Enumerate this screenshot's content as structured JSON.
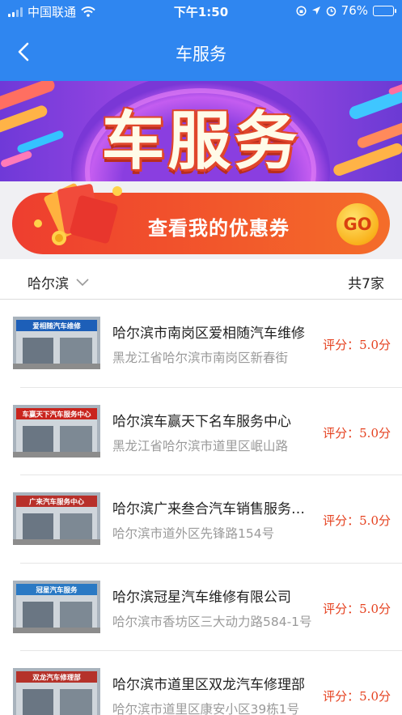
{
  "status_bar": {
    "carrier": "中国联通",
    "time": "下午1:50",
    "battery": "76%",
    "battery_level": 0.76
  },
  "nav": {
    "title": "车服务"
  },
  "banner": {
    "text": "车服务"
  },
  "coupon": {
    "label": "查看我的优惠券",
    "go_label": "GO"
  },
  "filter": {
    "city": "哈尔滨",
    "count": "共7家"
  },
  "shops": [
    {
      "name": "哈尔滨市南岗区爱相随汽车维修",
      "address": "黑龙江省哈尔滨市南岗区新春街",
      "rating": "评分：5.0分",
      "thumb_sign": "爱相随汽车维修",
      "sign_color": "#1d5fb8"
    },
    {
      "name": "哈尔滨车赢天下名车服务中心",
      "address": "黑龙江省哈尔滨市道里区岷山路",
      "rating": "评分：5.0分",
      "thumb_sign": "车赢天下汽车服务中心",
      "sign_color": "#c9241d"
    },
    {
      "name": "哈尔滨广来叁合汽车销售服务有限公司",
      "address": "哈尔滨市道外区先锋路154号",
      "rating": "评分：5.0分",
      "thumb_sign": "广来汽车服务中心",
      "sign_color": "#b8302a"
    },
    {
      "name": "哈尔滨冠星汽车维修有限公司",
      "address": "哈尔滨市香坊区三大动力路584-1号",
      "rating": "评分：5.0分",
      "thumb_sign": "冠星汽车服务",
      "sign_color": "#2a79c4"
    },
    {
      "name": "哈尔滨市道里区双龙汽车修理部",
      "address": "哈尔滨市道里区康安小区39栋1号",
      "rating": "评分：5.0分",
      "thumb_sign": "双龙汽车修理部",
      "sign_color": "#b5322a"
    }
  ]
}
